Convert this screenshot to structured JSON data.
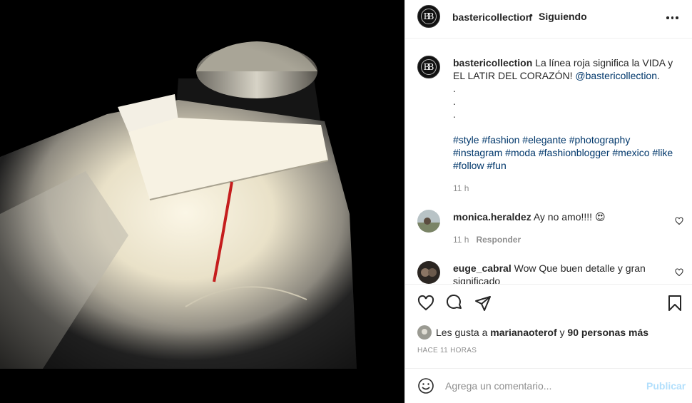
{
  "post": {
    "username": "bastericollection",
    "separator": "•",
    "follow_status": "Siguiendo",
    "avatar_monogram": "BB"
  },
  "caption": {
    "username": "bastericollection",
    "text": "La línea roja significa la VIDA y EL LATIR DEL CORAZÓN!",
    "mention": "@bastericollection",
    "mention_suffix": ".",
    "dots": [
      ".",
      ".",
      "."
    ],
    "hashtags_line1": [
      "#style",
      "#fashion",
      "#elegante",
      "#photography"
    ],
    "hashtags_line2": [
      "#instagram",
      "#moda",
      "#fashionblogger",
      "#mexico",
      "#like"
    ],
    "hashtags_line3": [
      "#follow",
      "#fun"
    ],
    "time": "11 h"
  },
  "comments": [
    {
      "username": "monica.heraldez",
      "text": "Ay no amo!!!! 😍",
      "time": "11 h",
      "reply_label": "Responder"
    },
    {
      "username": "euge_cabral",
      "text": "Wow Que buen detalle y gran significado"
    }
  ],
  "likes": {
    "prefix": "Les gusta a",
    "user": "marianaoterof",
    "conjunction": "y",
    "others": "90 personas más"
  },
  "timestamp": "HACE 11 HORAS",
  "add_comment": {
    "placeholder": "Agrega un comentario...",
    "post_label": "Publicar"
  },
  "icons": [
    "more-options-icon",
    "heart-icon",
    "comment-icon",
    "share-icon",
    "bookmark-icon",
    "emoji-icon"
  ],
  "colors": {
    "link": "#00376b",
    "muted": "#8e8e8e",
    "publish_disabled": "#b2dffc"
  }
}
